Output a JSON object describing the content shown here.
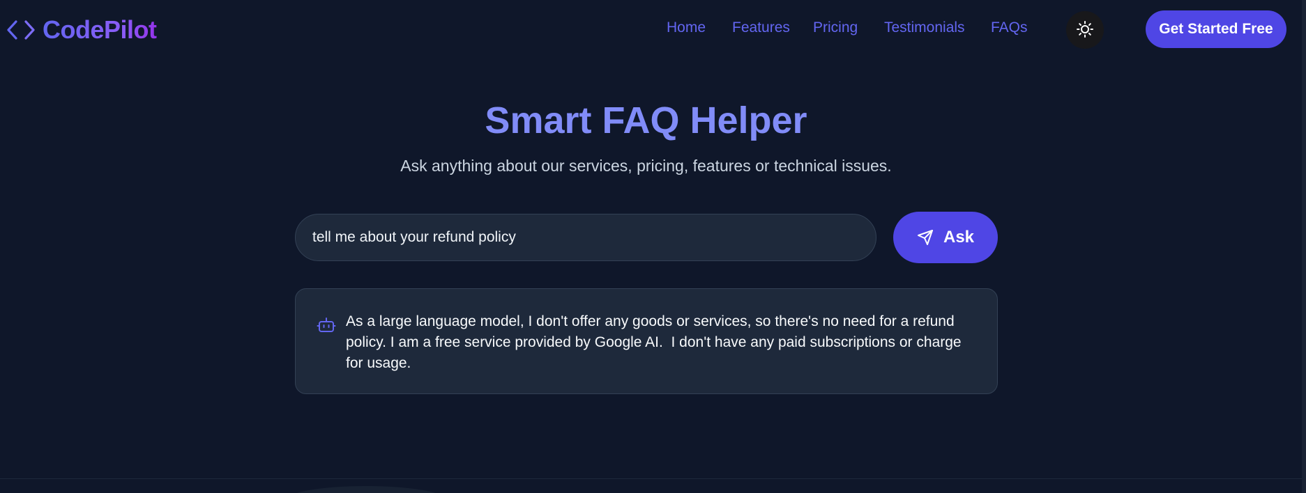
{
  "brand": {
    "name": "CodePilot",
    "icon": "code-brackets-icon",
    "gradient": [
      "#6366f1",
      "#9333ea"
    ]
  },
  "nav": {
    "links": [
      {
        "label": "Home"
      },
      {
        "label": "Features"
      },
      {
        "label": "Pricing"
      },
      {
        "label": "Testimonials"
      },
      {
        "label": "FAQs"
      }
    ],
    "theme_toggle_icon": "sun-icon",
    "cta_label": "Get Started Free"
  },
  "hero": {
    "title": "Smart FAQ Helper",
    "subtitle": "Ask anything about our services, pricing, features or technical issues."
  },
  "search": {
    "value": "tell me about your refund policy",
    "ask_label": "Ask",
    "ask_icon": "send-icon"
  },
  "answer": {
    "icon": "bot-icon",
    "lines": [
      "As a large language model, I don't offer any goods or services, so there's no need for a refund",
      "policy. I am a free service provided by Google AI.  I don't have any paid subscriptions or charge",
      "for usage."
    ]
  },
  "colors": {
    "background": "#0f172a",
    "accent": "#4f46e5",
    "link": "#6366f1",
    "title": "#818cf8",
    "card": "#1e293b"
  }
}
